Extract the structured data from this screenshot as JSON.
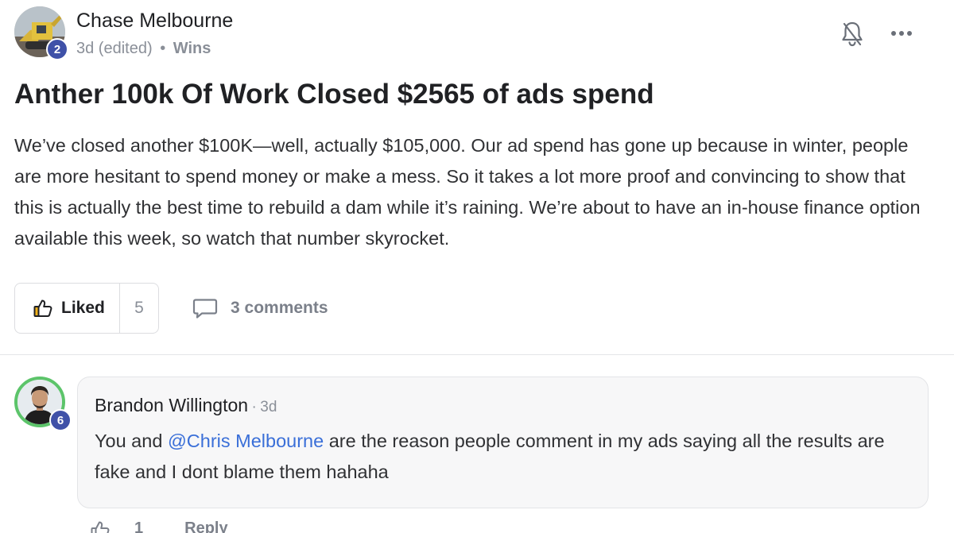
{
  "post": {
    "author": {
      "name": "Chase Melbourne",
      "level": "2",
      "avatar_icon": "excavator-photo-avatar"
    },
    "meta": {
      "time": "3d (edited)",
      "separator": "•",
      "category": "Wins"
    },
    "title": "Anther 100k Of Work Closed $2565 of ads spend",
    "body": "We’ve closed another $100K—well, actually $105,000. Our ad spend has gone up because in winter, people are more hesitant to spend money or make a mess. So it takes a lot more proof and convincing to show that this is actually the best time to rebuild a dam while it’s raining. We’re about to have an in-house finance option available this week, so watch that number skyrocket.",
    "actions": {
      "like_label": "Liked",
      "like_count": "5",
      "comments_label": "3 comments"
    },
    "header_icons": [
      "bell-off-icon",
      "more-options-icon"
    ]
  },
  "comment": {
    "author": {
      "name": "Brandon Willington",
      "level": "6",
      "avatar_icon": "person-photo-avatar"
    },
    "separator": "·",
    "time": "3d",
    "text_before": "You and ",
    "mention": "@Chris Melbourne",
    "text_after": " are the reason people comment in my ads saying all the results are fake and I dont blame them hahaha",
    "reply_row": {
      "like_count": "1",
      "reply_label": "Reply"
    }
  },
  "colors": {
    "level_badge": "#3f51a8",
    "online_ring": "#5cc46a",
    "mention": "#3a6fd8",
    "muted_text": "#8a8f98",
    "bubble_bg": "#f7f7f8"
  }
}
